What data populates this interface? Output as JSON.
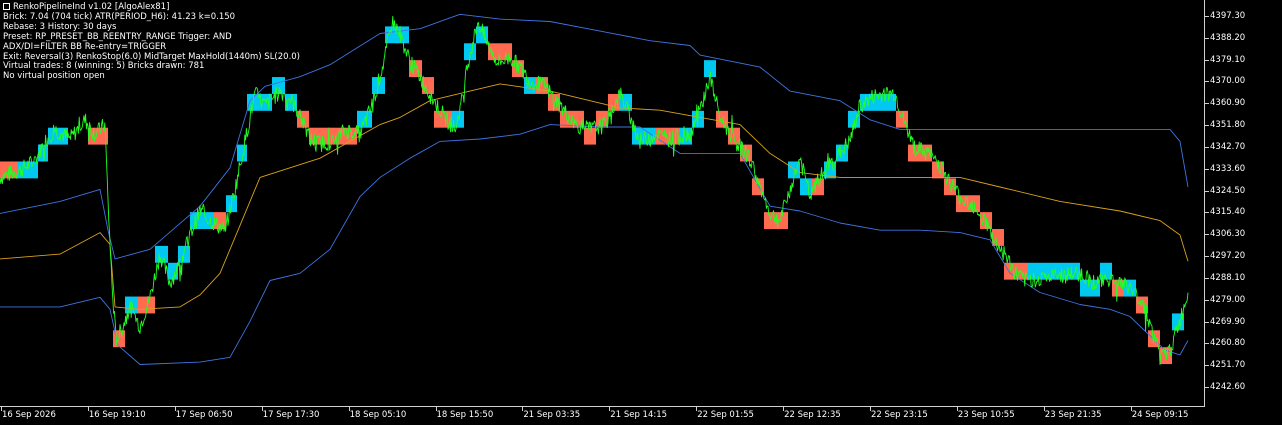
{
  "header": {
    "lines": [
      "RenkoPipelineInd v1.02  [AlgoAlex81]",
      "Brick: 7.04 (704 tick)  ATR(PERIOD_H6): 41.23  k=0.150",
      "Rebase: 3   History: 30 days",
      "Preset: RP_PRESET_BB_REENTRY_RANGE  Trigger: AND",
      "ADX/DI=FILTER  BB Re-entry=TRIGGER",
      "Exit: Reversal(3) RenkoStop(6.0) MidTarget MaxHold(1440m) SL(20.0)",
      "Virtual trades: 8  (winning: 5)   Bricks drawn: 781",
      "No virtual position open"
    ]
  },
  "colors": {
    "background": "#000000",
    "up_brick": "#00c8f0",
    "down_brick": "#ff6a50",
    "price": "#22ff22",
    "bb_bands": "#3f74e0",
    "bb_mid": "#d9a21b",
    "axis": "#d0d0d0"
  },
  "chart_data": {
    "type": "line",
    "subtype": "renko-bricks-with-bollinger-bands",
    "y_ticks": [
      "4397.30",
      "4388.20",
      "4379.10",
      "4370.00",
      "4360.90",
      "4351.80",
      "4342.70",
      "4333.60",
      "4324.50",
      "4315.40",
      "4306.30",
      "4297.20",
      "4288.10",
      "4279.00",
      "4269.90",
      "4260.80",
      "4251.70",
      "4242.60"
    ],
    "x_ticks": [
      "16 Sep 2026",
      "16 Sep 19:10",
      "17 Sep 06:50",
      "17 Sep 17:30",
      "18 Sep 05:10",
      "18 Sep 15:50",
      "21 Sep 03:35",
      "21 Sep 14:15",
      "22 Sep 01:55",
      "22 Sep 12:35",
      "22 Sep 23:15",
      "23 Sep 10:55",
      "23 Sep 21:35",
      "24 Sep 09:15"
    ],
    "ylim": [
      4236.5,
      4402.0
    ],
    "x_range": [
      0,
      1204
    ],
    "brick_size": 7.04,
    "price_path": [
      [
        0,
        4330
      ],
      [
        20,
        4333
      ],
      [
        35,
        4337
      ],
      [
        45,
        4345
      ],
      [
        55,
        4350
      ],
      [
        70,
        4346
      ],
      [
        85,
        4354
      ],
      [
        95,
        4348
      ],
      [
        105,
        4352
      ],
      [
        108,
        4320
      ],
      [
        112,
        4285
      ],
      [
        116,
        4262
      ],
      [
        122,
        4267
      ],
      [
        130,
        4276
      ],
      [
        140,
        4268
      ],
      [
        150,
        4280
      ],
      [
        160,
        4298
      ],
      [
        170,
        4286
      ],
      [
        180,
        4294
      ],
      [
        190,
        4306
      ],
      [
        200,
        4316
      ],
      [
        210,
        4312
      ],
      [
        225,
        4308
      ],
      [
        235,
        4325
      ],
      [
        245,
        4345
      ],
      [
        255,
        4365
      ],
      [
        265,
        4360
      ],
      [
        280,
        4366
      ],
      [
        290,
        4363
      ],
      [
        300,
        4356
      ],
      [
        310,
        4346
      ],
      [
        320,
        4344
      ],
      [
        335,
        4345
      ],
      [
        345,
        4350
      ],
      [
        360,
        4348
      ],
      [
        372,
        4360
      ],
      [
        385,
        4380
      ],
      [
        392,
        4395
      ],
      [
        400,
        4390
      ],
      [
        410,
        4378
      ],
      [
        420,
        4372
      ],
      [
        432,
        4363
      ],
      [
        445,
        4355
      ],
      [
        455,
        4350
      ],
      [
        462,
        4362
      ],
      [
        468,
        4378
      ],
      [
        478,
        4395
      ],
      [
        488,
        4385
      ],
      [
        498,
        4378
      ],
      [
        510,
        4380
      ],
      [
        520,
        4376
      ],
      [
        530,
        4370
      ],
      [
        545,
        4368
      ],
      [
        560,
        4360
      ],
      [
        575,
        4352
      ],
      [
        590,
        4350
      ],
      [
        605,
        4352
      ],
      [
        620,
        4365
      ],
      [
        630,
        4356
      ],
      [
        640,
        4345
      ],
      [
        655,
        4348
      ],
      [
        670,
        4346
      ],
      [
        690,
        4348
      ],
      [
        700,
        4358
      ],
      [
        710,
        4372
      ],
      [
        720,
        4355
      ],
      [
        735,
        4345
      ],
      [
        750,
        4338
      ],
      [
        760,
        4326
      ],
      [
        770,
        4315
      ],
      [
        780,
        4312
      ],
      [
        790,
        4325
      ],
      [
        800,
        4338
      ],
      [
        810,
        4322
      ],
      [
        820,
        4330
      ],
      [
        835,
        4338
      ],
      [
        850,
        4345
      ],
      [
        860,
        4360
      ],
      [
        875,
        4364
      ],
      [
        895,
        4365
      ],
      [
        905,
        4352
      ],
      [
        915,
        4342
      ],
      [
        930,
        4340
      ],
      [
        940,
        4335
      ],
      [
        950,
        4328
      ],
      [
        960,
        4322
      ],
      [
        975,
        4318
      ],
      [
        985,
        4312
      ],
      [
        995,
        4303
      ],
      [
        1005,
        4298
      ],
      [
        1015,
        4290
      ],
      [
        1025,
        4287
      ],
      [
        1040,
        4288
      ],
      [
        1060,
        4289
      ],
      [
        1080,
        4290
      ],
      [
        1095,
        4286
      ],
      [
        1110,
        4288
      ],
      [
        1130,
        4284
      ],
      [
        1145,
        4276
      ],
      [
        1155,
        4262
      ],
      [
        1162,
        4255
      ],
      [
        1170,
        4258
      ],
      [
        1180,
        4270
      ],
      [
        1188,
        4282
      ]
    ],
    "bb_upper": [
      [
        0,
        4315
      ],
      [
        60,
        4320
      ],
      [
        100,
        4325
      ],
      [
        108,
        4308
      ],
      [
        115,
        4296
      ],
      [
        150,
        4300
      ],
      [
        200,
        4318
      ],
      [
        230,
        4334
      ],
      [
        240,
        4348
      ],
      [
        250,
        4362
      ],
      [
        265,
        4368
      ],
      [
        300,
        4372
      ],
      [
        330,
        4377
      ],
      [
        380,
        4390
      ],
      [
        420,
        4392
      ],
      [
        460,
        4398
      ],
      [
        500,
        4396
      ],
      [
        550,
        4395
      ],
      [
        600,
        4391
      ],
      [
        650,
        4387
      ],
      [
        690,
        4385
      ],
      [
        700,
        4381
      ],
      [
        760,
        4376
      ],
      [
        790,
        4366
      ],
      [
        840,
        4362
      ],
      [
        870,
        4354
      ],
      [
        900,
        4350
      ],
      [
        1000,
        4350
      ],
      [
        1100,
        4350
      ],
      [
        1170,
        4350
      ],
      [
        1180,
        4345
      ],
      [
        1188,
        4326
      ]
    ],
    "bb_mid": [
      [
        0,
        4296
      ],
      [
        60,
        4298
      ],
      [
        100,
        4307
      ],
      [
        110,
        4302
      ],
      [
        115,
        4276
      ],
      [
        140,
        4275
      ],
      [
        180,
        4276
      ],
      [
        200,
        4281
      ],
      [
        220,
        4290
      ],
      [
        240,
        4310
      ],
      [
        260,
        4330
      ],
      [
        290,
        4334
      ],
      [
        320,
        4338
      ],
      [
        350,
        4345
      ],
      [
        380,
        4352
      ],
      [
        400,
        4355
      ],
      [
        430,
        4362
      ],
      [
        470,
        4366
      ],
      [
        500,
        4369
      ],
      [
        550,
        4366
      ],
      [
        590,
        4362
      ],
      [
        620,
        4359
      ],
      [
        660,
        4358
      ],
      [
        700,
        4355
      ],
      [
        740,
        4352
      ],
      [
        770,
        4340
      ],
      [
        800,
        4332
      ],
      [
        840,
        4330
      ],
      [
        870,
        4330
      ],
      [
        920,
        4330
      ],
      [
        960,
        4330
      ],
      [
        1000,
        4326
      ],
      [
        1060,
        4320
      ],
      [
        1120,
        4316
      ],
      [
        1160,
        4312
      ],
      [
        1180,
        4306
      ],
      [
        1188,
        4295
      ]
    ],
    "bb_lower": [
      [
        0,
        4276
      ],
      [
        60,
        4276
      ],
      [
        100,
        4280
      ],
      [
        110,
        4275
      ],
      [
        118,
        4260
      ],
      [
        140,
        4252
      ],
      [
        200,
        4253
      ],
      [
        230,
        4255
      ],
      [
        250,
        4270
      ],
      [
        270,
        4287
      ],
      [
        300,
        4290
      ],
      [
        330,
        4300
      ],
      [
        360,
        4322
      ],
      [
        380,
        4330
      ],
      [
        410,
        4338
      ],
      [
        440,
        4345
      ],
      [
        480,
        4346
      ],
      [
        520,
        4348
      ],
      [
        550,
        4352
      ],
      [
        600,
        4351
      ],
      [
        640,
        4351
      ],
      [
        680,
        4340
      ],
      [
        740,
        4340
      ],
      [
        770,
        4318
      ],
      [
        800,
        4316
      ],
      [
        840,
        4311
      ],
      [
        880,
        4308
      ],
      [
        920,
        4308
      ],
      [
        960,
        4307
      ],
      [
        990,
        4304
      ],
      [
        1010,
        4290
      ],
      [
        1040,
        4282
      ],
      [
        1080,
        4277
      ],
      [
        1110,
        4275
      ],
      [
        1130,
        4272
      ],
      [
        1150,
        4264
      ],
      [
        1165,
        4258
      ],
      [
        1180,
        4256
      ],
      [
        1188,
        4262
      ]
    ],
    "bricks": [
      [
        0,
        "D"
      ],
      [
        18,
        "U"
      ],
      [
        38,
        "U"
      ],
      [
        48,
        "U"
      ],
      [
        88,
        "D"
      ],
      [
        113,
        "D"
      ],
      [
        125,
        "U"
      ],
      [
        137,
        "D"
      ],
      [
        155,
        "U"
      ],
      [
        168,
        "U"
      ],
      [
        178,
        "U"
      ],
      [
        190,
        "U"
      ],
      [
        202,
        "U"
      ],
      [
        214,
        "D"
      ],
      [
        226,
        "U"
      ],
      [
        237,
        "U"
      ],
      [
        247,
        "U"
      ],
      [
        260,
        "U"
      ],
      [
        272,
        "U"
      ],
      [
        285,
        "U"
      ],
      [
        297,
        "D"
      ],
      [
        309,
        "D"
      ],
      [
        321,
        "D"
      ],
      [
        333,
        "D"
      ],
      [
        345,
        "D"
      ],
      [
        357,
        "U"
      ],
      [
        372,
        "U"
      ],
      [
        385,
        "U"
      ],
      [
        395,
        "U"
      ],
      [
        409,
        "D"
      ],
      [
        422,
        "D"
      ],
      [
        434,
        "D"
      ],
      [
        452,
        "U"
      ],
      [
        464,
        "U"
      ],
      [
        476,
        "U"
      ],
      [
        488,
        "D"
      ],
      [
        500,
        "D"
      ],
      [
        512,
        "D"
      ],
      [
        524,
        "U"
      ],
      [
        536,
        "D"
      ],
      [
        548,
        "D"
      ],
      [
        560,
        "D"
      ],
      [
        572,
        "D"
      ],
      [
        584,
        "D"
      ],
      [
        596,
        "D"
      ],
      [
        608,
        "D"
      ],
      [
        620,
        "U"
      ],
      [
        632,
        "U"
      ],
      [
        644,
        "U"
      ],
      [
        656,
        "D"
      ],
      [
        668,
        "D"
      ],
      [
        680,
        "U"
      ],
      [
        692,
        "U"
      ],
      [
        704,
        "U"
      ],
      [
        716,
        "D"
      ],
      [
        728,
        "D"
      ],
      [
        740,
        "D"
      ],
      [
        752,
        "D"
      ],
      [
        764,
        "D"
      ],
      [
        776,
        "D"
      ],
      [
        788,
        "U"
      ],
      [
        800,
        "U"
      ],
      [
        812,
        "D"
      ],
      [
        824,
        "U"
      ],
      [
        836,
        "U"
      ],
      [
        848,
        "U"
      ],
      [
        860,
        "U"
      ],
      [
        872,
        "U"
      ],
      [
        884,
        "U"
      ],
      [
        896,
        "D"
      ],
      [
        908,
        "D"
      ],
      [
        920,
        "D"
      ],
      [
        932,
        "D"
      ],
      [
        944,
        "D"
      ],
      [
        956,
        "D"
      ],
      [
        968,
        "D"
      ],
      [
        980,
        "D"
      ],
      [
        992,
        "D"
      ],
      [
        1004,
        "D"
      ],
      [
        1016,
        "D"
      ],
      [
        1028,
        "U"
      ],
      [
        1040,
        "U"
      ],
      [
        1060,
        "U"
      ],
      [
        1080,
        "U"
      ],
      [
        1100,
        "U"
      ],
      [
        1112,
        "D"
      ],
      [
        1124,
        "U"
      ],
      [
        1136,
        "D"
      ],
      [
        1148,
        "D"
      ],
      [
        1160,
        "D"
      ],
      [
        1172,
        "U"
      ]
    ]
  }
}
